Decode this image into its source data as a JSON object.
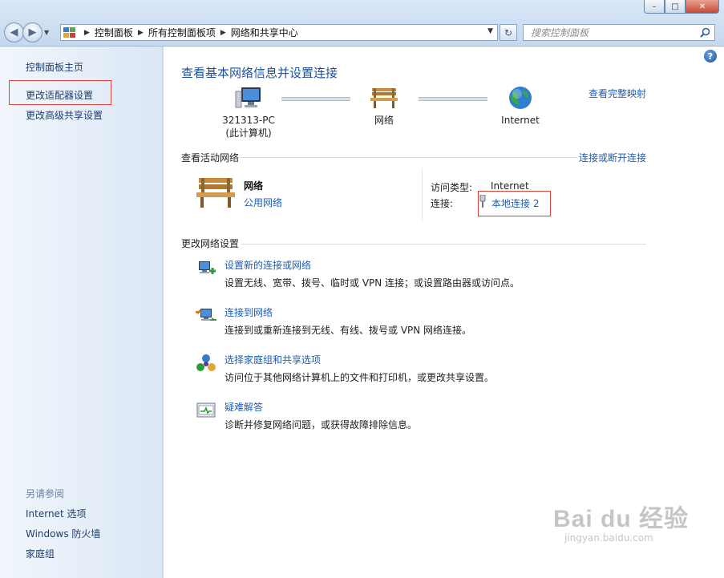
{
  "window": {
    "buttons": {
      "minimize": "–",
      "maximize": "□",
      "close": "✕"
    }
  },
  "navigation": {
    "back_icon": "back-arrow-icon",
    "forward_icon": "forward-arrow-icon",
    "breadcrumbs": [
      "控制面板",
      "所有控制面板项",
      "网络和共享中心"
    ],
    "search": {
      "placeholder": "搜索控制面板"
    }
  },
  "sidebar": {
    "items": [
      {
        "label": "控制面板主页"
      },
      {
        "label": "更改适配器设置",
        "highlighted": true
      },
      {
        "label": "更改高级共享设置"
      }
    ],
    "see_also_label": "另请参阅",
    "see_also": [
      {
        "label": "Internet 选项"
      },
      {
        "label": "Windows 防火墙"
      },
      {
        "label": "家庭组"
      }
    ]
  },
  "main": {
    "help": "?",
    "title": "查看基本网络信息并设置连接",
    "full_map_link": "查看完整映射",
    "map": {
      "computer_name": "321313-PC",
      "computer_sub": "(此计算机)",
      "network": "网络",
      "internet": "Internet"
    },
    "active_networks": {
      "heading": "查看活动网络",
      "connect_link": "连接或断开连接",
      "network_name": "网络",
      "network_type": "公用网络",
      "access_type_label": "访问类型:",
      "access_type_value": "Internet",
      "connections_label": "连接:",
      "connection_value": "本地连接 2"
    },
    "change_settings": {
      "heading": "更改网络设置",
      "tasks": [
        {
          "icon": "new-connection-icon",
          "link": "设置新的连接或网络",
          "desc": "设置无线、宽带、拨号、临时或 VPN 连接；或设置路由器或访问点。"
        },
        {
          "icon": "connect-network-icon",
          "link": "连接到网络",
          "desc": "连接到或重新连接到无线、有线、拨号或 VPN 网络连接。"
        },
        {
          "icon": "homegroup-icon",
          "link": "选择家庭组和共享选项",
          "desc": "访问位于其他网络计算机上的文件和打印机，或更改共享设置。"
        },
        {
          "icon": "troubleshoot-icon",
          "link": "疑难解答",
          "desc": "诊断并修复网络问题，或获得故障排除信息。"
        }
      ]
    }
  },
  "watermark": {
    "brand": "Bai du 经验",
    "url": "jingyan.baidu.com"
  },
  "colors": {
    "link": "#1d5cb5",
    "title": "#1f4f9a",
    "highlight_box": "#e0413b"
  }
}
